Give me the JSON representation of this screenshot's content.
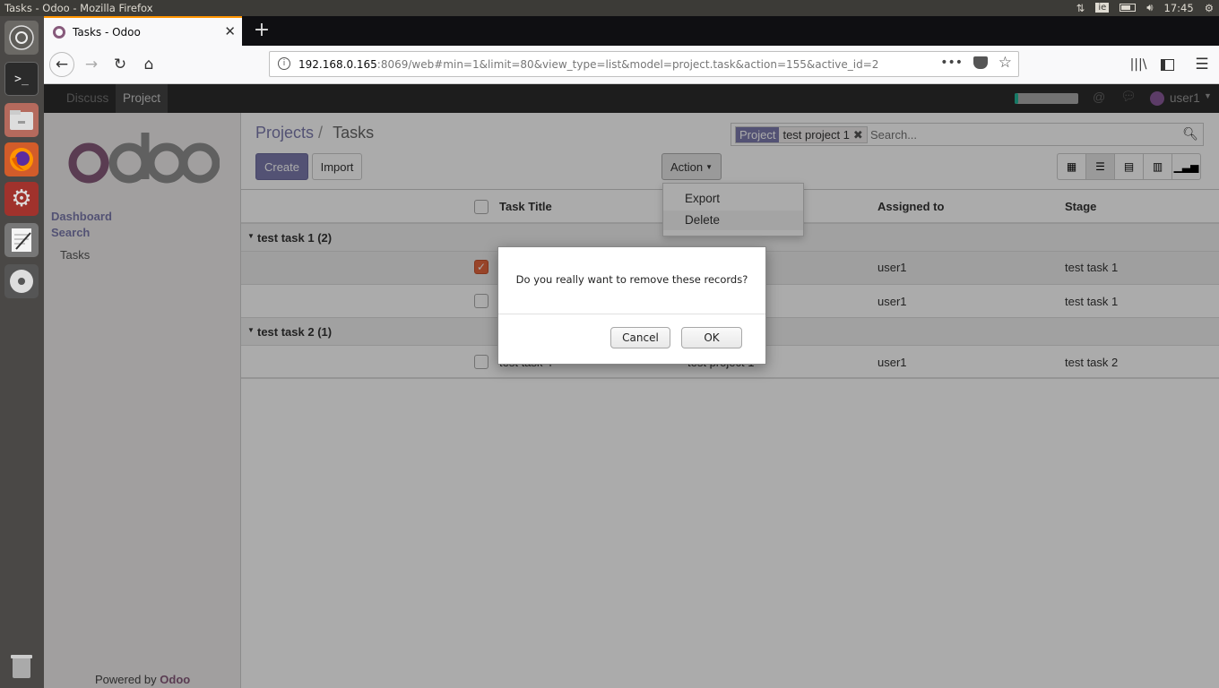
{
  "os": {
    "window_title": "Tasks - Odoo - Mozilla Firefox",
    "clock": "17:45",
    "keyboard": "ie"
  },
  "browser": {
    "tab_title": "Tasks - Odoo",
    "new_tab": "+",
    "url_host": "192.168.0.165",
    "url_rest": ":8069/web#min=1&limit=80&view_type=list&model=project.task&action=155&active_id=2"
  },
  "odoo": {
    "menu": [
      "Discuss",
      "Project"
    ],
    "user": "user1",
    "sidebar": {
      "logo": "odoo",
      "dashboard": "Dashboard",
      "search": "Search",
      "tasks": "Tasks",
      "powered_by": "Powered by",
      "powered_brand": "Odoo"
    },
    "breadcrumb": {
      "parent": "Projects",
      "sep": "/",
      "current": "Tasks"
    },
    "buttons": {
      "create": "Create",
      "import": "Import",
      "action": "Action"
    },
    "search": {
      "facet_label": "Project",
      "facet_value": "test project 1",
      "placeholder": "Search..."
    },
    "action_menu": [
      "Export",
      "Delete"
    ],
    "columns": {
      "title": "Task Title",
      "assigned": "Assigned to",
      "stage": "Stage"
    },
    "groups": [
      {
        "name": "test task 1 (2)"
      },
      {
        "name": "test task 2 (1)"
      }
    ],
    "rows": [
      {
        "title": "",
        "project": "",
        "assigned": "user1",
        "stage": "test task 1",
        "checked": true
      },
      {
        "title": "",
        "project": "",
        "assigned": "user1",
        "stage": "test task 1",
        "checked": false
      },
      {
        "title": "test task 4",
        "project": "test project 1",
        "assigned": "user1",
        "stage": "test task 2",
        "checked": false
      }
    ]
  },
  "dialog": {
    "message": "Do you really want to remove these records?",
    "cancel": "Cancel",
    "ok": "OK"
  }
}
